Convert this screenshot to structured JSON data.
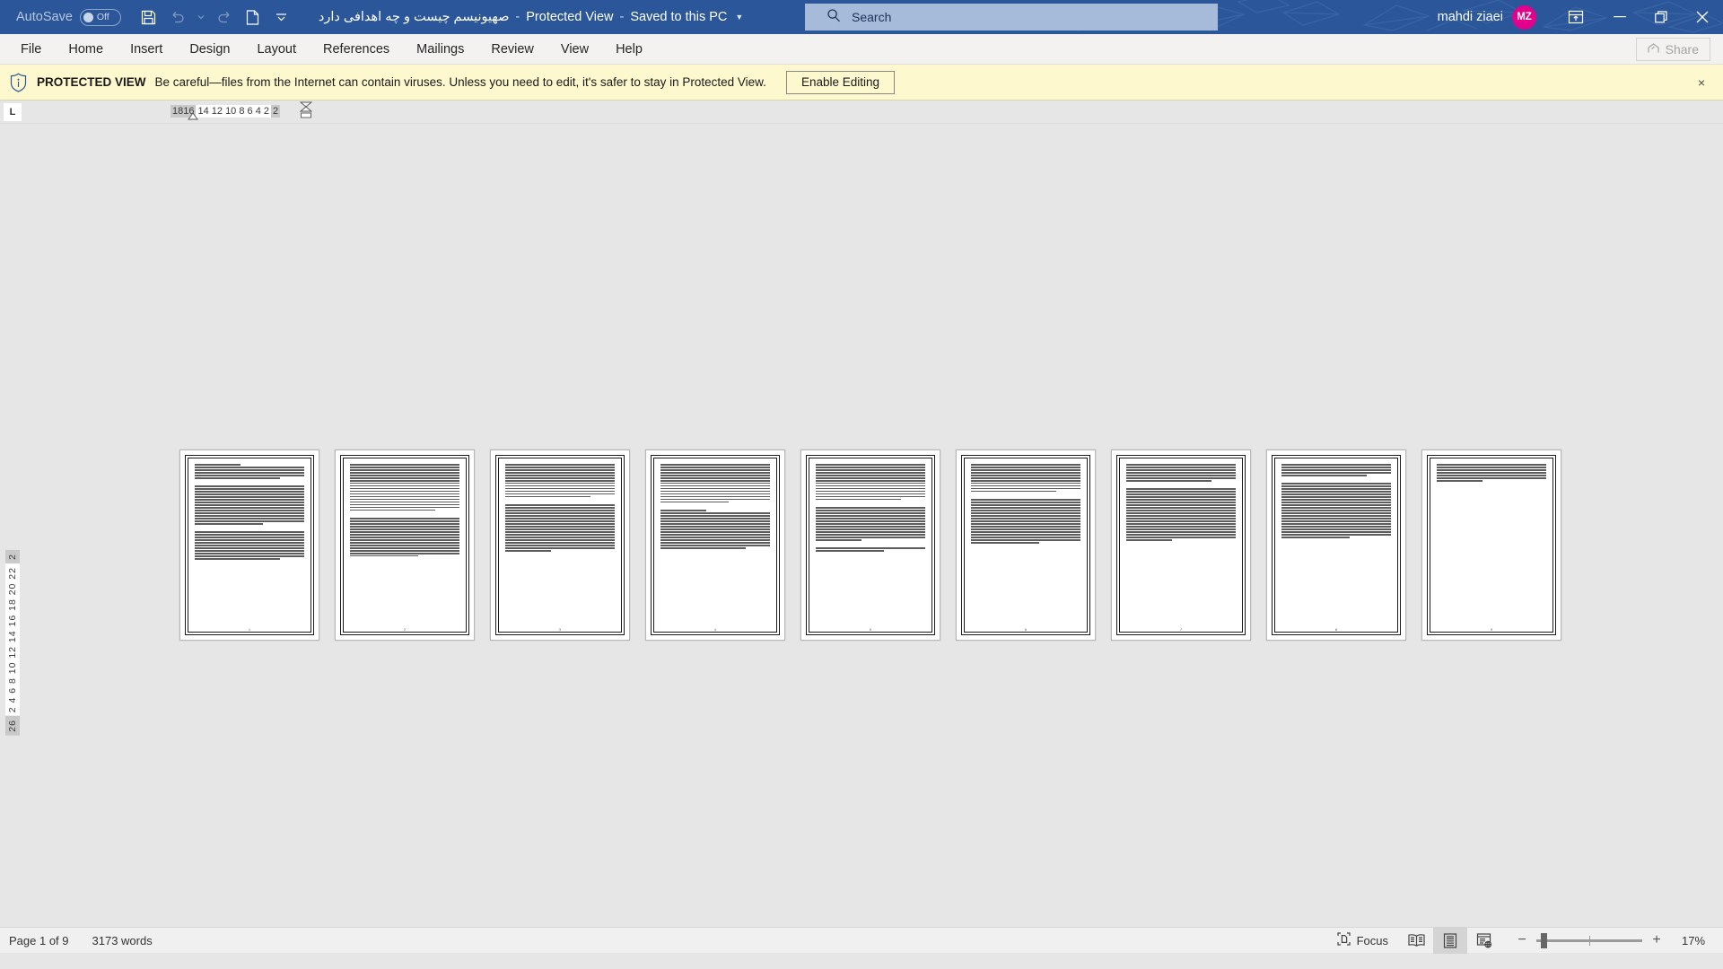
{
  "titlebar": {
    "autosave_label": "AutoSave",
    "autosave_state": "Off",
    "quick_access": [
      {
        "name": "save-icon",
        "label": "Save"
      },
      {
        "name": "undo-icon",
        "label": "Undo"
      },
      {
        "name": "undo-dropdown-icon",
        "label": "Undo options"
      },
      {
        "name": "redo-icon",
        "label": "Redo"
      },
      {
        "name": "new-document-icon",
        "label": "New"
      },
      {
        "name": "customize-qat-icon",
        "label": "Customize Quick Access Toolbar"
      }
    ],
    "document_title": "صهیونیسم چیست و چه اهدافی دارد",
    "separator": "-",
    "protected_view_label": "Protected View",
    "save_location": "Saved to this PC",
    "search_placeholder": "Search",
    "user_name": "mahdi ziaei",
    "user_initials": "MZ",
    "window_buttons": [
      {
        "name": "ribbon-display-options-icon",
        "label": "Ribbon Display Options"
      },
      {
        "name": "minimize-icon",
        "label": "Minimize"
      },
      {
        "name": "restore-icon",
        "label": "Restore Down"
      },
      {
        "name": "close-icon",
        "label": "Close"
      }
    ]
  },
  "ribbon": {
    "tabs": [
      {
        "label": "File"
      },
      {
        "label": "Home"
      },
      {
        "label": "Insert"
      },
      {
        "label": "Design"
      },
      {
        "label": "Layout"
      },
      {
        "label": "References"
      },
      {
        "label": "Mailings"
      },
      {
        "label": "Review"
      },
      {
        "label": "View"
      },
      {
        "label": "Help"
      }
    ],
    "share_label": "Share"
  },
  "protected_view": {
    "badge": "PROTECTED VIEW",
    "message": "Be careful—files from the Internet can contain viruses. Unless you need to edit, it's safer to stay in Protected View.",
    "enable_button": "Enable Editing",
    "close_label": "×"
  },
  "ruler": {
    "tab_stop_marker": "L",
    "horizontal_left_gray": "1816",
    "horizontal_white": "14 12 10  8   6   4   2",
    "horizontal_right_gray": "2",
    "vertical_top_gray": "2",
    "vertical_white": "2  4  6  8 10 12 14 16 18 20 22",
    "vertical_bottom_gray": "26"
  },
  "document": {
    "page_count": 9,
    "pages": [
      {
        "number": "1"
      },
      {
        "number": "2"
      },
      {
        "number": "3"
      },
      {
        "number": "4"
      },
      {
        "number": "5"
      },
      {
        "number": "6"
      },
      {
        "number": "7"
      },
      {
        "number": "8"
      },
      {
        "number": "9"
      }
    ]
  },
  "statusbar": {
    "page_indicator": "Page 1 of 9",
    "word_count": "3173 words",
    "focus_label": "Focus",
    "view_buttons": [
      {
        "name": "read-mode-icon",
        "label": "Read Mode",
        "active": false
      },
      {
        "name": "print-layout-icon",
        "label": "Print Layout",
        "active": true
      },
      {
        "name": "web-layout-icon",
        "label": "Web Layout",
        "active": false
      }
    ],
    "zoom_out": "−",
    "zoom_in": "+",
    "zoom_level": "17%"
  },
  "colors": {
    "title_bar": "#2b579a",
    "accent_avatar": "#e3008c",
    "protected_bar": "#fdf8cd",
    "canvas": "#e6e6e6"
  }
}
